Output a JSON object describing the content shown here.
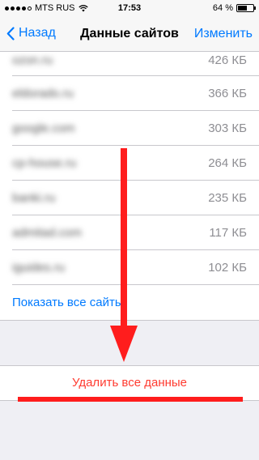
{
  "status_bar": {
    "carrier": "MTS RUS",
    "time": "17:53",
    "battery_text": "64 %",
    "battery_level": 0.64,
    "signal_bars_filled": 4,
    "signal_bars_total": 5,
    "icons": [
      "wifi-icon",
      "battery-icon"
    ]
  },
  "nav": {
    "back_label": "Назад",
    "title": "Данные сайтов",
    "edit_label": "Изменить",
    "icon": "chevron-left-icon"
  },
  "sites": [
    {
      "name": "ozon.ru",
      "size": "426 КБ"
    },
    {
      "name": "eldorado.ru",
      "size": "366 КБ"
    },
    {
      "name": "google.com",
      "size": "303 КБ"
    },
    {
      "name": "cp-house.ru",
      "size": "264 КБ"
    },
    {
      "name": "banki.ru",
      "size": "235 КБ"
    },
    {
      "name": "admitad.com",
      "size": "117 КБ"
    },
    {
      "name": "iguides.ru",
      "size": "102 КБ"
    }
  ],
  "show_all_label": "Показать все сайты",
  "delete_all_label": "Удалить все данные",
  "colors": {
    "accent": "#007aff",
    "destructive": "#ff3b30",
    "annotation": "#ff1d1d",
    "background": "#efeff4"
  }
}
